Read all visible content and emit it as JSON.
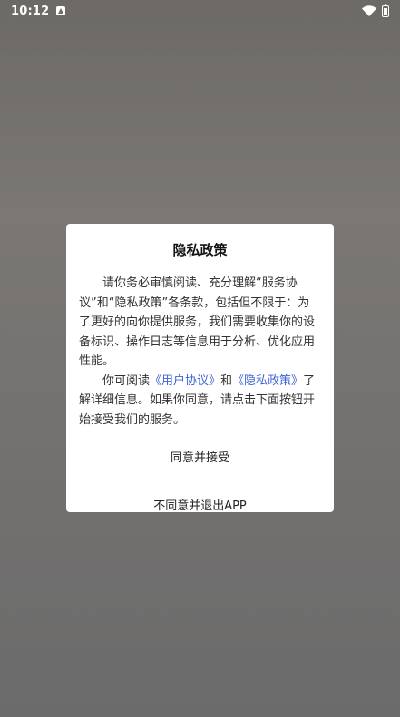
{
  "status_bar": {
    "time": "10:12"
  },
  "dialog": {
    "title": "隐私政策",
    "paragraph1": "请你务必审慎阅读、充分理解“服务协议”和“隐私政策”各条款，包括但不限于：为了更好的向你提供服务，我们需要收集你的设备标识、操作日志等信息用于分析、优化应用性能。",
    "p2_before": "你可阅读",
    "user_agreement_link": "《用户协议》",
    "p2_and": "和",
    "privacy_policy_link": "《隐私政策》",
    "p2_after": "了解详细信息。如果你同意，请点击下面按钮开始接受我们的服务。",
    "agree_label": "同意并接受",
    "disagree_label": "不同意并退出APP"
  },
  "colors": {
    "link": "#3f63d9",
    "overlay": "#6d6a66"
  }
}
